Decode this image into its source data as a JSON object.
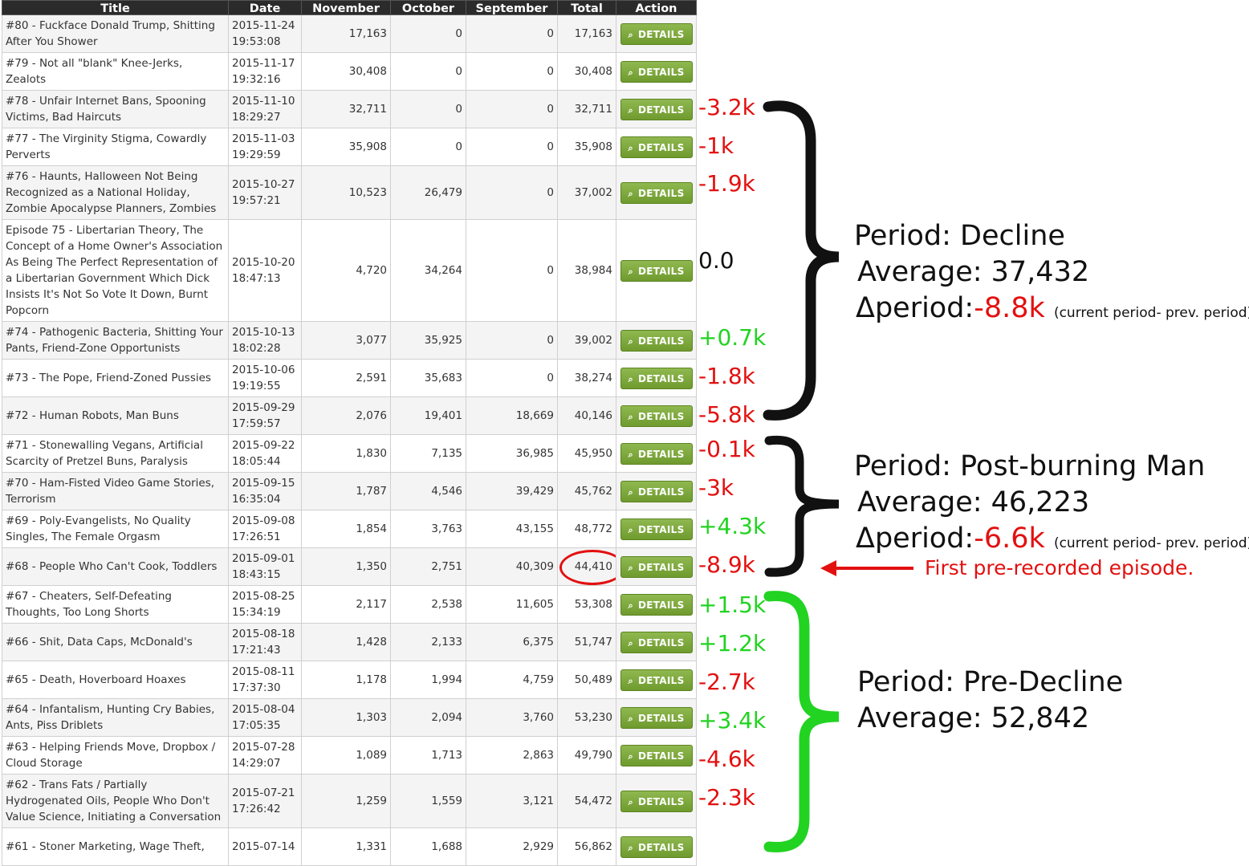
{
  "table": {
    "headers": [
      "Title",
      "Date",
      "November",
      "October",
      "September",
      "Total",
      "Action"
    ],
    "action_label": "DETAILS",
    "rows": [
      {
        "title": "#80 - Fuckface Donald Trump, Shitting After You Shower",
        "date": "2015-11-24 19:53:08",
        "november": "17,163",
        "october": "0",
        "september": "0",
        "total": "17,163"
      },
      {
        "title": "#79 - Not all \"blank\" Knee-Jerks, Zealots",
        "date": "2015-11-17 19:32:16",
        "november": "30,408",
        "october": "0",
        "september": "0",
        "total": "30,408"
      },
      {
        "title": "#78 - Unfair Internet Bans, Spooning Victims, Bad Haircuts",
        "date": "2015-11-10 18:29:27",
        "november": "32,711",
        "october": "0",
        "september": "0",
        "total": "32,711"
      },
      {
        "title": "#77 - The Virginity Stigma, Cowardly Perverts",
        "date": "2015-11-03 19:29:59",
        "november": "35,908",
        "october": "0",
        "september": "0",
        "total": "35,908"
      },
      {
        "title": "#76 - Haunts, Halloween Not Being Recognized as a National Holiday, Zombie Apocalypse Planners, Zombies",
        "date": "2015-10-27 19:57:21",
        "november": "10,523",
        "october": "26,479",
        "september": "0",
        "total": "37,002"
      },
      {
        "title": "Episode 75 - Libertarian Theory, The Concept of a Home Owner's Association As Being The Perfect Representation of a Libertarian Government Which Dick Insists It's Not So Vote It Down, Burnt Popcorn",
        "date": "2015-10-20 18:47:13",
        "november": "4,720",
        "october": "34,264",
        "september": "0",
        "total": "38,984"
      },
      {
        "title": "#74 - Pathogenic Bacteria, Shitting Your Pants, Friend-Zone Opportunists",
        "date": "2015-10-13 18:02:28",
        "november": "3,077",
        "october": "35,925",
        "september": "0",
        "total": "39,002"
      },
      {
        "title": "#73 - The Pope, Friend-Zoned Pussies",
        "date": "2015-10-06 19:19:55",
        "november": "2,591",
        "october": "35,683",
        "september": "0",
        "total": "38,274"
      },
      {
        "title": "#72 - Human Robots, Man Buns",
        "date": "2015-09-29 17:59:57",
        "november": "2,076",
        "october": "19,401",
        "september": "18,669",
        "total": "40,146"
      },
      {
        "title": "#71 - Stonewalling Vegans, Artificial Scarcity of Pretzel Buns, Paralysis",
        "date": "2015-09-22 18:05:44",
        "november": "1,830",
        "october": "7,135",
        "september": "36,985",
        "total": "45,950"
      },
      {
        "title": "#70 - Ham-Fisted Video Game Stories, Terrorism",
        "date": "2015-09-15 16:35:04",
        "november": "1,787",
        "october": "4,546",
        "september": "39,429",
        "total": "45,762"
      },
      {
        "title": "#69 - Poly-Evangelists, No Quality Singles, The Female Orgasm",
        "date": "2015-09-08 17:26:51",
        "november": "1,854",
        "october": "3,763",
        "september": "43,155",
        "total": "48,772"
      },
      {
        "title": "#68 - People Who Can't Cook, Toddlers",
        "date": "2015-09-01 18:43:15",
        "november": "1,350",
        "october": "2,751",
        "september": "40,309",
        "total": "44,410"
      },
      {
        "title": "#67 - Cheaters, Self-Defeating Thoughts, Too Long Shorts",
        "date": "2015-08-25 15:34:19",
        "november": "2,117",
        "october": "2,538",
        "september": "11,605",
        "total": "53,308"
      },
      {
        "title": "#66 - Shit, Data Caps, McDonald's",
        "date": "2015-08-18 17:21:43",
        "november": "1,428",
        "october": "2,133",
        "september": "6,375",
        "total": "51,747"
      },
      {
        "title": "#65 - Death, Hoverboard Hoaxes",
        "date": "2015-08-11 17:37:30",
        "november": "1,178",
        "october": "1,994",
        "september": "4,759",
        "total": "50,489"
      },
      {
        "title": "#64 - Infantalism, Hunting Cry Babies, Ants, Piss Driblets",
        "date": "2015-08-04 17:05:35",
        "november": "1,303",
        "october": "2,094",
        "september": "3,760",
        "total": "53,230"
      },
      {
        "title": "#63 - Helping Friends Move, Dropbox / Cloud Storage",
        "date": "2015-07-28 14:29:07",
        "november": "1,089",
        "october": "1,713",
        "september": "2,863",
        "total": "49,790"
      },
      {
        "title": "#62 - Trans Fats / Partially Hydrogenated Oils, People Who Don't Value Science, Initiating a Conversation",
        "date": "2015-07-21 17:26:42",
        "november": "1,259",
        "october": "1,559",
        "september": "3,121",
        "total": "54,472"
      },
      {
        "title": "#61 - Stoner Marketing, Wage Theft,",
        "date": "2015-07-14",
        "november": "1,331",
        "october": "1,688",
        "september": "2,929",
        "total": "56,862"
      }
    ]
  },
  "annotations": {
    "deltas": [
      {
        "text": "-3.2k",
        "color": "red"
      },
      {
        "text": "-1k",
        "color": "red"
      },
      {
        "text": "-1.9k",
        "color": "red"
      },
      {
        "text": "0.0",
        "color": "black"
      },
      {
        "text": "+0.7k",
        "color": "green"
      },
      {
        "text": "-1.8k",
        "color": "red"
      },
      {
        "text": "-5.8k",
        "color": "red"
      },
      {
        "text": "-0.1k",
        "color": "red"
      },
      {
        "text": "-3k",
        "color": "red"
      },
      {
        "text": "+4.3k",
        "color": "green"
      },
      {
        "text": "-8.9k",
        "color": "red"
      },
      {
        "text": "+1.5k",
        "color": "green"
      },
      {
        "text": "+1.2k",
        "color": "green"
      },
      {
        "text": "-2.7k",
        "color": "red"
      },
      {
        "text": "+3.4k",
        "color": "green"
      },
      {
        "text": "-4.6k",
        "color": "red"
      },
      {
        "text": "-2.3k",
        "color": "red"
      }
    ],
    "periods": {
      "decline": {
        "period": "Period: Decline",
        "average": "Average: 37,432",
        "delta_label": "Δperiod:",
        "delta_value": "-8.8k",
        "note": "(current period- prev. period)"
      },
      "post_burning_man": {
        "period": "Period: Post-burning Man",
        "average": "Average: 46,223",
        "delta_label": "Δperiod:",
        "delta_value": "-6.6k",
        "note": "(current period- prev. period)"
      },
      "pre_decline": {
        "period": "Period: Pre-Decline",
        "average": "Average: 52,842"
      }
    },
    "first_prerecorded_note": "First pre-recorded episode.",
    "highlighted_total_row": 12,
    "colors": {
      "red": "#e31010",
      "green": "#22d322",
      "black": "#111111",
      "button": "#7ba73a"
    }
  }
}
